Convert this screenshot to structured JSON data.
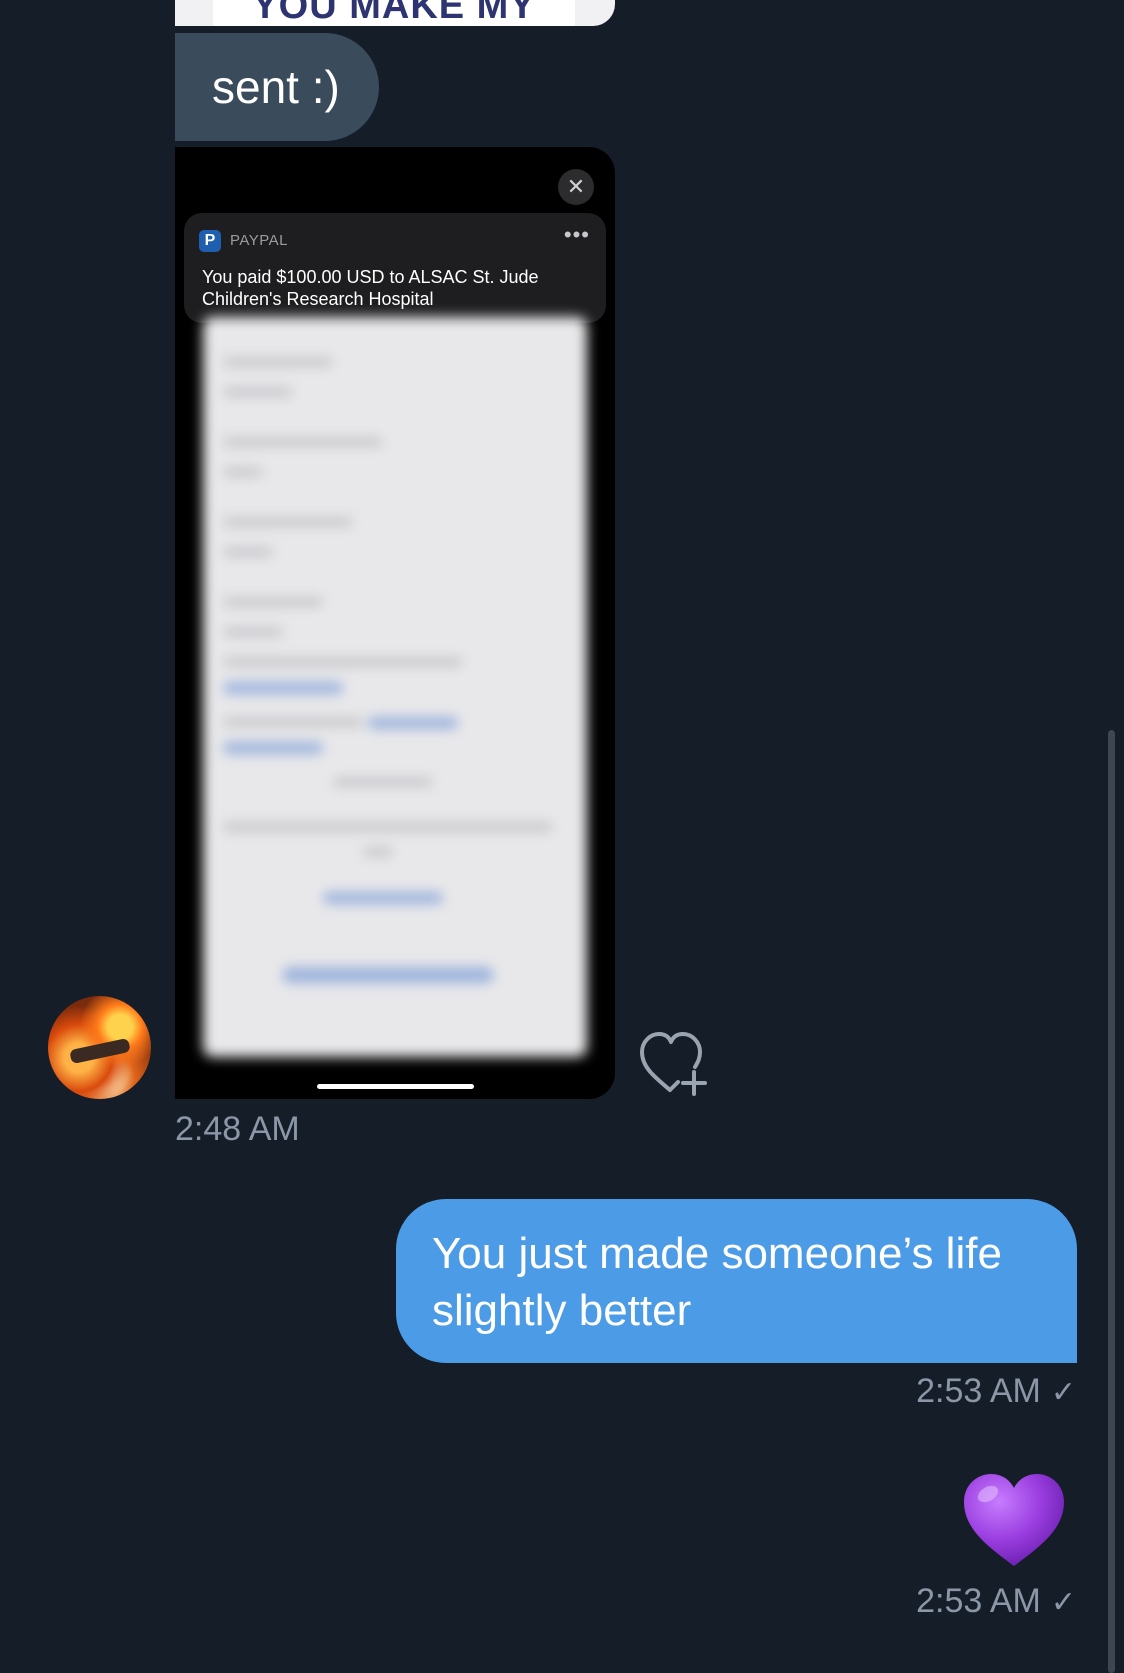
{
  "top_image": {
    "text": "YOU MAKE MY"
  },
  "messages": {
    "incoming_text": "sent :)",
    "screenshot": {
      "notification": {
        "app_name": "PAYPAL",
        "more_label": "•••",
        "body": "You paid $100.00 USD to ALSAC St. Jude Children's Research Hospital"
      },
      "close_label": "✕"
    },
    "incoming_time": "2:48 AM",
    "outgoing_text": "You just made someone’s life slightly better",
    "outgoing_time": "2:53 AM",
    "outgoing_check": "✓",
    "emoji_time": "2:53 AM",
    "emoji_check": "✓"
  },
  "colors": {
    "background": "#151d29",
    "incoming_bubble": "#3a4b5c",
    "outgoing_bubble": "#4c9be6",
    "heart": "#9b3ee0"
  },
  "icons": {
    "like": "heart-plus-icon",
    "close": "close-icon",
    "paypal": "paypal-logo-icon",
    "emoji": "purple-heart-emoji"
  }
}
